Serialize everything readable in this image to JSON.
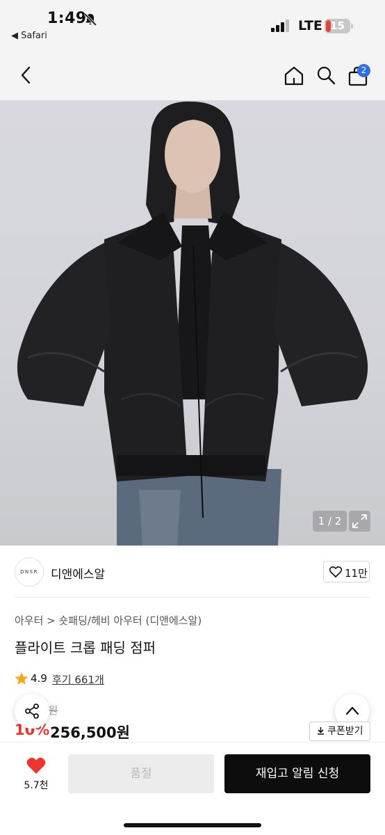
{
  "status_bar": {
    "time": "1:49",
    "back_app": "◀ Safari",
    "network": "LTE",
    "battery": "15"
  },
  "nav": {
    "cart_count": "2"
  },
  "gallery": {
    "pager": "1 / 2"
  },
  "brand": {
    "logo_text": "DNSR",
    "name": "디앤에스알",
    "likes": "11만"
  },
  "product": {
    "breadcrumb": "아우터 > 숏패딩/헤비 아우터 (디앤에스알)",
    "title": "플라이트 크롭 패딩 점퍼",
    "rating": "4.9",
    "reviews": "후기 661개",
    "original_price": "0원",
    "discount": "10%",
    "sale_price": "256,500원",
    "coupon": "쿠폰받기"
  },
  "bottom_bar": {
    "wish_count": "5.7천",
    "option_label": "품절",
    "restock_label": "재입고 알림 신청"
  },
  "colors": {
    "accent_red": "#f0352c",
    "badge_blue": "#2f6fe0",
    "cta_black": "#0d0d0d"
  }
}
